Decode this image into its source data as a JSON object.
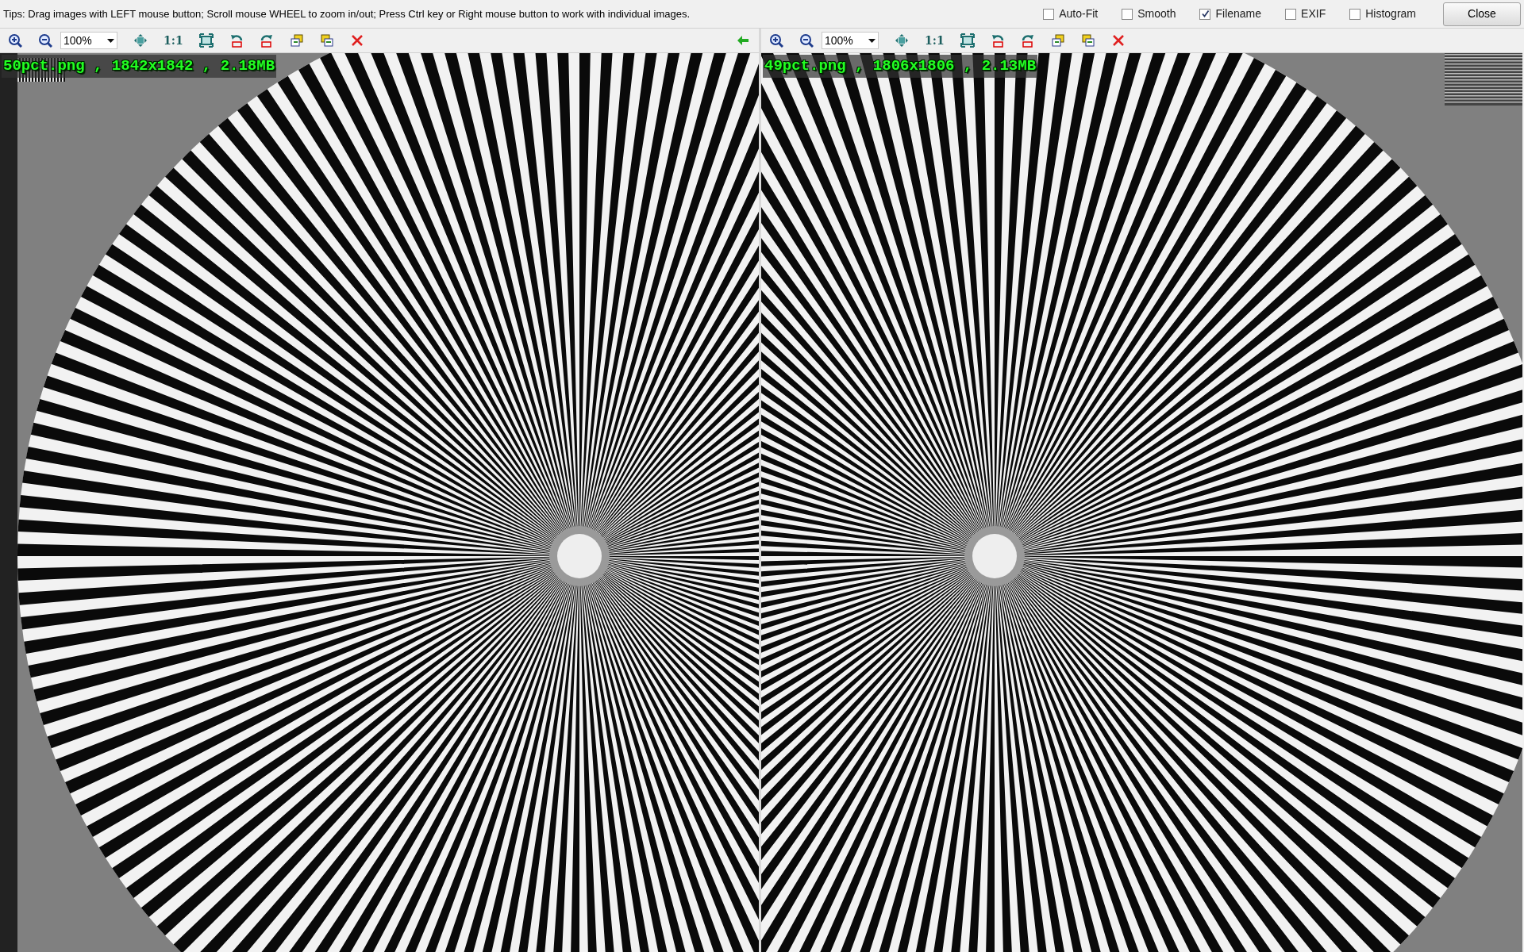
{
  "tips": "Tips: Drag images with LEFT mouse button; Scroll mouse WHEEL to zoom in/out; Press Ctrl key or Right mouse button to work with individual images.",
  "options": [
    {
      "label": "Auto-Fit",
      "checked": false
    },
    {
      "label": "Smooth",
      "checked": false
    },
    {
      "label": "Filename",
      "checked": true
    },
    {
      "label": "EXIF",
      "checked": false
    },
    {
      "label": "Histogram",
      "checked": false
    }
  ],
  "close_button": "Close",
  "panes": [
    {
      "zoom": "100%",
      "ratio": "1:1",
      "link_arrow": true,
      "filename": "50pct.png , 1842x1842 , 2.18MB"
    },
    {
      "zoom": "100%",
      "ratio": "1:1",
      "link_arrow": false,
      "filename": "49pct.png , 1806x1806 , 2.13MB"
    }
  ]
}
